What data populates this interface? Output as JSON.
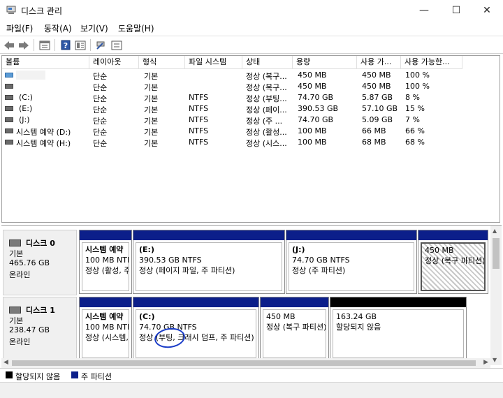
{
  "window": {
    "title": "디스크 관리",
    "icon": "disk-management-icon",
    "minimize_glyph": "—",
    "maximize_glyph": "☐",
    "close_glyph": "✕"
  },
  "menu": [
    "파일(F)",
    "동작(A)",
    "보기(V)",
    "도움말(H)"
  ],
  "toolbar": {
    "icons": [
      "back-arrow-icon",
      "forward-arrow-icon",
      "properties-icon",
      "help-icon",
      "view-icon",
      "connect-icon",
      "list-icon"
    ]
  },
  "volume_list": {
    "columns": [
      "볼륨",
      "레이아웃",
      "형식",
      "파일 시스템",
      "상태",
      "용량",
      "사용 가...",
      "사용 가능한..."
    ],
    "rows": [
      {
        "volume": "",
        "layout": "단순",
        "type": "기본",
        "fs": "",
        "status": "정상 (복구...",
        "capacity": "450 MB",
        "free": "450 MB",
        "pct": "100 %"
      },
      {
        "volume": "",
        "layout": "단순",
        "type": "기본",
        "fs": "",
        "status": "정상 (복구...",
        "capacity": "450 MB",
        "free": "450 MB",
        "pct": "100 %"
      },
      {
        "volume": "(C:)",
        "layout": "단순",
        "type": "기본",
        "fs": "NTFS",
        "status": "정상 (부팅...",
        "capacity": "74.70 GB",
        "free": "5.87 GB",
        "pct": "8 %"
      },
      {
        "volume": "(E:)",
        "layout": "단순",
        "type": "기본",
        "fs": "NTFS",
        "status": "정상 (페이...",
        "capacity": "390.53 GB",
        "free": "57.10 GB",
        "pct": "15 %"
      },
      {
        "volume": "(J:)",
        "layout": "단순",
        "type": "기본",
        "fs": "NTFS",
        "status": "정상 (주 ...",
        "capacity": "74.70 GB",
        "free": "5.09 GB",
        "pct": "7 %"
      },
      {
        "volume": "시스템 예약 (D:)",
        "layout": "단순",
        "type": "기본",
        "fs": "NTFS",
        "status": "정상 (활성...",
        "capacity": "100 MB",
        "free": "66 MB",
        "pct": "66 %"
      },
      {
        "volume": "시스템 예약 (H:)",
        "layout": "단순",
        "type": "기본",
        "fs": "NTFS",
        "status": "정상 (시스...",
        "capacity": "100 MB",
        "free": "68 MB",
        "pct": "68 %"
      }
    ]
  },
  "disks": [
    {
      "name": "디스크 0",
      "type": "기본",
      "size": "465.76 GB",
      "state": "온라인",
      "partitions": [
        {
          "title": "시스템 예약",
          "size": "100 MB NTFS",
          "status": "정상 (활성, 주 파티션)"
        },
        {
          "title": "(E:)",
          "size": "390.53 GB NTFS",
          "status": "정상 (페이지 파일, 주 파티션)"
        },
        {
          "title": "(J:)",
          "size": "74.70 GB NTFS",
          "status": "정상 (주 파티션)"
        },
        {
          "title": "",
          "size": "450 MB",
          "status": "정상 (복구 파티션)"
        }
      ]
    },
    {
      "name": "디스크 1",
      "type": "기본",
      "size": "238.47 GB",
      "state": "온라인",
      "partitions": [
        {
          "title": "시스템 예약",
          "size": "100 MB NTFS",
          "status": "정상 (시스템, 활성, 주 파티션)"
        },
        {
          "title": "(C:)",
          "size": "74.70 GB NTFS",
          "status": "정상 (부팅, 크래시 덤프, 주 파티션)"
        },
        {
          "title": "",
          "size": "450 MB",
          "status": "정상 (복구 파티션)"
        },
        {
          "title": "",
          "size": "163.24 GB",
          "status": "할당되지 않음"
        }
      ]
    }
  ],
  "legend": [
    {
      "label": "할당되지 않음",
      "color": "#000000"
    },
    {
      "label": "주 파티션",
      "color": "#0c1f8a"
    }
  ],
  "colors": {
    "primary_partition": "#0c1f8a",
    "unallocated": "#000000",
    "annotation": "#1a3cc7"
  }
}
